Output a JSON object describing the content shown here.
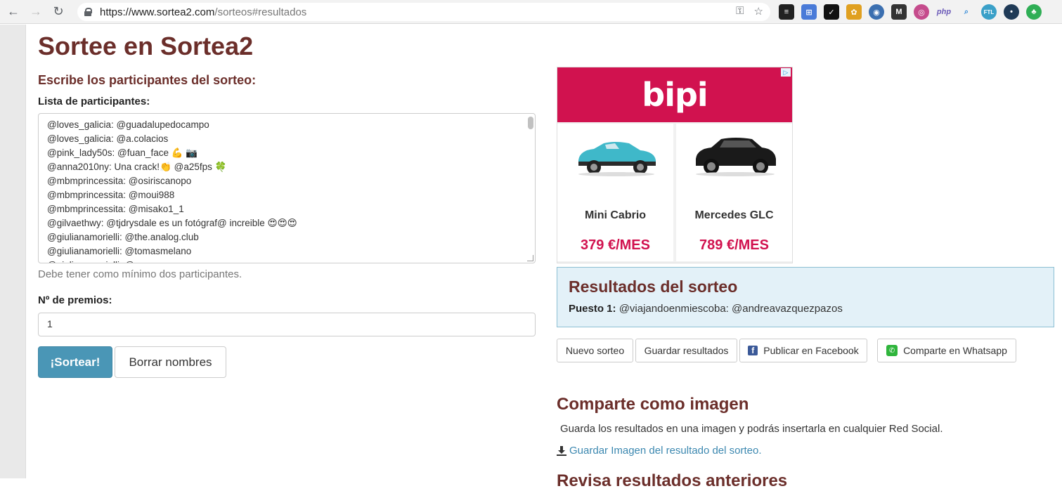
{
  "browser": {
    "url_host": "https://www.sortea2.com",
    "url_path": "/sorteos#resultados",
    "extensions": [
      "layers",
      "translate",
      "ticket",
      "stamp",
      "shield",
      "M",
      "camera",
      "php",
      "search",
      "FTL",
      "dot",
      "leaf"
    ]
  },
  "page": {
    "title": "Sortee en Sortea2",
    "subheading": "Escribe los participantes del sorteo:",
    "participants_label": "Lista de participantes:",
    "participants": [
      "@loves_galicia: @guadalupedocampo",
      "@loves_galicia: @a.colacios",
      "@pink_lady50s: @fuan_face 💪 📷",
      "@anna2010ny: Una crack!👏 @a25fps 🍀",
      "@mbmprincessita: @osiriscanopo",
      "@mbmprincessita: @moui988",
      "@mbmprincessita: @misako1_1",
      "@gilvaethwy: @tjdrysdale es un fotógraf@ increible 😍😍😍",
      "@giulianamorielli: @the.analog.club",
      "@giulianamorielli: @tomasmelano",
      "@giulianamorielli: @..."
    ],
    "help_text": "Debe tener como mínimo dos participantes.",
    "prizes_label": "Nº de premios:",
    "prizes_value": "1",
    "draw_button": "¡Sortear!",
    "clear_button": "Borrar nombres"
  },
  "ad": {
    "brand": "bipi",
    "cars": [
      {
        "name": "Mini Cabrio",
        "price": "379 €/MES",
        "color": "#3fb8c9"
      },
      {
        "name": "Mercedes GLC",
        "price": "789 €/MES",
        "color": "#1a1a1a"
      }
    ]
  },
  "results": {
    "title": "Resultados del sorteo",
    "place_label": "Puesto 1:",
    "place_value": "@viajandoenmiescoba: @andreavazquezpazos"
  },
  "actions": {
    "new_draw": "Nuevo sorteo",
    "save_results": "Guardar resultados",
    "facebook": "Publicar en Facebook",
    "whatsapp": "Comparte en Whatsapp"
  },
  "share_image": {
    "title": "Comparte como imagen",
    "text": "Guarda los resultados en una imagen y podrás insertarla en cualquier Red Social.",
    "link": "Guardar Imagen del resultado del sorteo."
  },
  "cutoff_heading": "Revisa resultados anteriores"
}
